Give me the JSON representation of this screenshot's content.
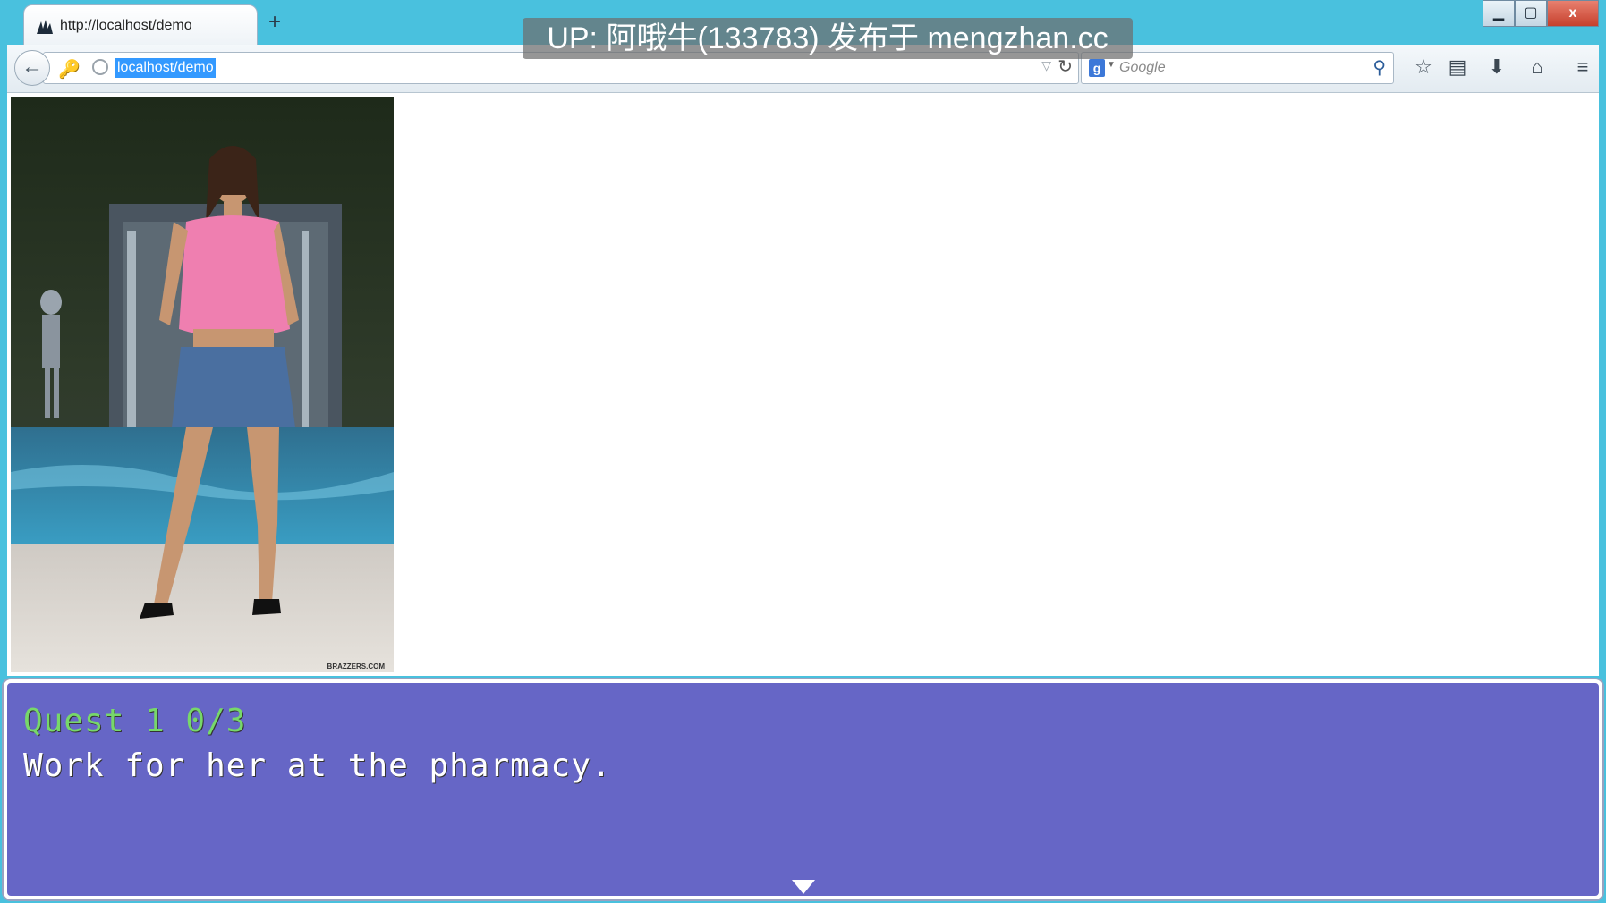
{
  "browser": {
    "tab_title": "http://localhost/demo",
    "new_tab_label": "+",
    "url": "localhost/demo",
    "search_placeholder": "Google",
    "search_engine_letter": "g",
    "window_controls": {
      "minimize": "▁",
      "maximize": "▢",
      "close": "x"
    },
    "icons": {
      "back": "←",
      "identity": "🔑",
      "dropdown": "▽",
      "reload": "↻",
      "search": "⚲",
      "bookmark": "☆",
      "reader": "▤",
      "download": "⬇",
      "home": "⌂",
      "menu": "≡"
    }
  },
  "overlay": {
    "watermark": "UP: 阿哦牛(133783) 发布于 mengzhan.cc"
  },
  "game": {
    "image_watermark": "BRAZZERS.COM",
    "quest_title": "Quest 1 0/3",
    "quest_description": "Work for her at the pharmacy."
  },
  "colors": {
    "frame": "#49c1de",
    "dialog_bg": "#6666c6",
    "quest_title": "#77d86a",
    "url_highlight": "#3399ff"
  }
}
